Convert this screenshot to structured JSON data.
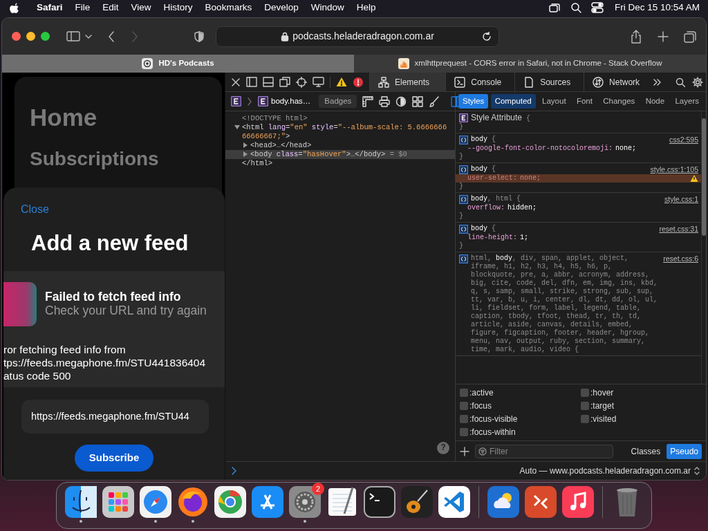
{
  "menubar": {
    "app": "Safari",
    "menus": [
      "File",
      "Edit",
      "View",
      "History",
      "Bookmarks",
      "Develop",
      "Window",
      "Help"
    ],
    "clock": "Fri Dec 15 10:54 AM"
  },
  "browser": {
    "nav": [
      {
        "kind": "back",
        "disabled": false
      },
      {
        "kind": "forward",
        "disabled": true
      }
    ],
    "url": "podcasts.heladeradragon.com.ar",
    "tabs": [
      {
        "title": "HD's Podcasts",
        "kind": "podcast",
        "selected": true
      },
      {
        "title": "xmlhttprequest - CORS error in Safari, not in Chrome - Stack Overflow",
        "kind": "stack",
        "selected": false
      }
    ]
  },
  "page": {
    "headings": [
      "Home",
      "Subscriptions"
    ],
    "sheet": {
      "close": "Close",
      "title": "Add a new feed",
      "error_title": "Failed to fetch feed info",
      "error_subtitle": "Check your URL and try again",
      "details": [
        "ror fetching feed info from",
        "tps://feeds.megaphone.fm/STU441836404",
        "atus code 500"
      ],
      "url_value": "https://feeds.megaphone.fm/STU44",
      "submit": "Subscribe"
    }
  },
  "devtools": {
    "tabs": [
      {
        "label": "Elements",
        "kind": "elements",
        "selected": true
      },
      {
        "label": "Console",
        "kind": "console",
        "selected": false
      },
      {
        "label": "Sources",
        "kind": "sources",
        "selected": false
      },
      {
        "label": "Network",
        "kind": "network",
        "selected": false
      }
    ],
    "breadcrumb": "body.has…",
    "badges": "Badges",
    "dom": [
      {
        "parts": [
          {
            "kind": "plain",
            "text": "<!DOCTYPE html>"
          }
        ],
        "selected": false
      },
      {
        "parts": [
          {
            "kind": "tag",
            "text": "<html"
          },
          {
            "kind": "attr",
            "text": " lang"
          },
          {
            "kind": "tag",
            "text": "="
          },
          {
            "kind": "value",
            "text": "\"en\""
          },
          {
            "kind": "attr",
            "text": " style"
          },
          {
            "kind": "tag",
            "text": "="
          },
          {
            "kind": "value",
            "text": "\"--album-scale: 5.666666666666667;\""
          },
          {
            "kind": "tag",
            "text": ">"
          }
        ],
        "expanded": true,
        "selected": false,
        "children": [
          {
            "parts": [
              {
                "kind": "tag",
                "text": "<head>"
              },
              {
                "kind": "plain",
                "text": "…"
              },
              {
                "kind": "tag",
                "text": "</head>"
              }
            ],
            "expanded": false,
            "selected": false
          },
          {
            "parts": [
              {
                "kind": "tag",
                "text": "<body"
              },
              {
                "kind": "attr",
                "text": " class"
              },
              {
                "kind": "tag",
                "text": "="
              },
              {
                "kind": "value",
                "text": "\"hasHover\""
              },
              {
                "kind": "tag",
                "text": ">"
              },
              {
                "kind": "plain",
                "text": "…"
              },
              {
                "kind": "tag",
                "text": "</body>"
              },
              {
                "kind": "plain",
                "text": " = $0"
              }
            ],
            "expanded": false,
            "selected": true
          }
        ],
        "closing": [
          {
            "kind": "tag",
            "text": "</html>"
          }
        ]
      }
    ],
    "help": "?",
    "sidebar_tabs": [
      {
        "label": "Styles",
        "selected": true,
        "highlighted": false
      },
      {
        "label": "Computed",
        "selected": false,
        "highlighted": true
      },
      {
        "label": "Layout",
        "selected": false,
        "highlighted": false
      },
      {
        "label": "Font",
        "selected": false,
        "highlighted": false
      },
      {
        "label": "Changes",
        "selected": false,
        "highlighted": false
      },
      {
        "label": "Node",
        "selected": false,
        "highlighted": false
      },
      {
        "label": "Layers",
        "selected": false,
        "highlighted": false
      }
    ],
    "rules": [
      {
        "kind": "attribute",
        "title": "Style Attribute",
        "open": "{",
        "close": "}"
      },
      {
        "kind": "rule",
        "selector": [
          {
            "text": "body",
            "matched": true
          }
        ],
        "open": "{",
        "close": "}",
        "source": "css2:595",
        "declarations": [
          {
            "property": "--google-font-color-notocoloremoji:",
            "value": "none;",
            "warning": false
          }
        ]
      },
      {
        "kind": "rule",
        "selector": [
          {
            "text": "body",
            "matched": true
          }
        ],
        "open": "{",
        "close": "}",
        "source": "style.css:1:105",
        "declarations": [
          {
            "property": "user-select:",
            "value": "none;",
            "warning": true
          }
        ]
      },
      {
        "kind": "rule",
        "selector": [
          {
            "text": "body",
            "matched": true
          },
          {
            "text": ", html",
            "matched": false
          }
        ],
        "open": "{",
        "close": "}",
        "source": "style.css:1",
        "declarations": [
          {
            "property": "overflow:",
            "value": "hidden;",
            "warning": false
          }
        ]
      },
      {
        "kind": "rule",
        "selector": [
          {
            "text": "body",
            "matched": true
          }
        ],
        "open": "{",
        "close": "}",
        "source": "reset.css:31",
        "declarations": [
          {
            "property": "line-height:",
            "value": "1;",
            "warning": false
          }
        ]
      },
      {
        "kind": "rule",
        "selector": [
          {
            "text": "html, ",
            "matched": false
          },
          {
            "text": "body",
            "matched": true
          },
          {
            "text": ", div, span, applet, object, iframe, h1, h2, h3, h4, h5, h6, p, blockquote, pre, a, abbr, acronym, address, big, cite, code, del, dfn, em, img, ins, kbd, q, s, samp, small, strike, strong, sub, sup, tt, var, b, u, i, center, dl, dt, dd, ol, ul, li, fieldset, form, label, legend, table, caption, tbody, tfoot, thead, tr, th, td, article, aside, canvas, details, embed, figure, figcaption, footer, header, hgroup, menu, nav, output, ruby, section, summary, time, mark, audio, video",
            "matched": false
          }
        ],
        "open": "{",
        "source": "reset.css:6"
      }
    ],
    "pseudo": [
      {
        "label": ":active",
        "checked": false
      },
      {
        "label": ":hover",
        "checked": false
      },
      {
        "label": ":focus",
        "checked": false
      },
      {
        "label": ":target",
        "checked": false
      },
      {
        "label": ":focus-visible",
        "checked": false
      },
      {
        "label": ":visited",
        "checked": false
      },
      {
        "label": ":focus-within",
        "checked": false
      }
    ],
    "filter_placeholder": "Filter",
    "toggles": [
      {
        "label": "Classes",
        "selected": false
      },
      {
        "label": "Pseudo",
        "selected": true
      }
    ],
    "console_context": "Auto — www.podcasts.heladeradragon.com.ar"
  },
  "dock": {
    "sections": [
      {
        "apps": [
          {
            "kind": "finder",
            "running": true
          },
          {
            "kind": "launchpad",
            "running": false
          },
          {
            "kind": "safari",
            "running": true
          },
          {
            "kind": "firefox",
            "running": true
          },
          {
            "kind": "chrome",
            "running": false
          },
          {
            "kind": "appstore",
            "running": false
          },
          {
            "kind": "settings",
            "running": true,
            "badge": "2"
          },
          {
            "kind": "textedit",
            "running": false
          },
          {
            "kind": "terminal",
            "running": false
          },
          {
            "kind": "garageband",
            "running": false
          },
          {
            "kind": "vscode",
            "running": false
          }
        ]
      },
      {
        "apps": [
          {
            "kind": "weather",
            "running": false
          },
          {
            "kind": "remote",
            "running": false
          },
          {
            "kind": "music",
            "running": false
          }
        ]
      },
      {
        "apps": [
          {
            "kind": "trash",
            "running": false
          }
        ]
      }
    ]
  }
}
